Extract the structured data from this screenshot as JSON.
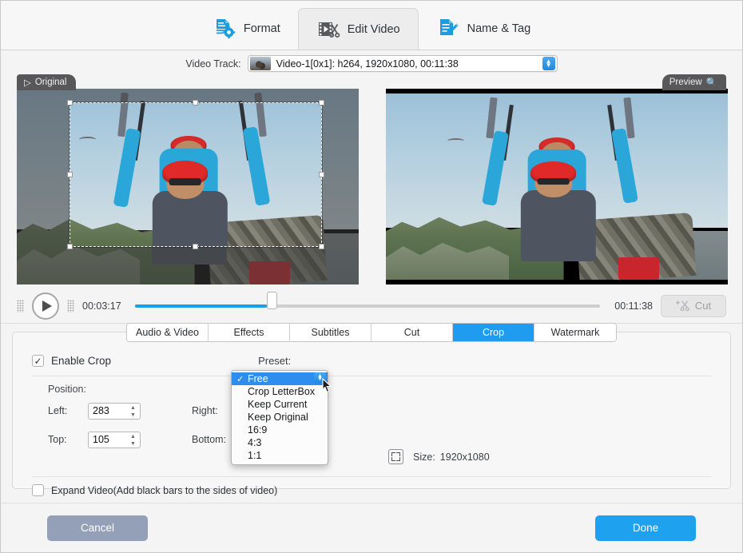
{
  "top_tabs": [
    {
      "label": "Format",
      "icon": "format-icon",
      "active": false
    },
    {
      "label": "Edit Video",
      "icon": "edit-video-icon",
      "active": true
    },
    {
      "label": "Name & Tag",
      "icon": "name-tag-icon",
      "active": false
    }
  ],
  "track": {
    "label": "Video Track:",
    "value": "Video-1[0x1]: h264, 1920x1080, 00:11:38"
  },
  "panes": {
    "original_label": "Original",
    "preview_label": "Preview"
  },
  "transport": {
    "current_time": "00:03:17",
    "total_time": "00:11:38",
    "cut_label": "Cut",
    "progress_percent": 28
  },
  "subtabs": [
    {
      "label": "Audio & Video",
      "active": false
    },
    {
      "label": "Effects",
      "active": false
    },
    {
      "label": "Subtitles",
      "active": false
    },
    {
      "label": "Cut",
      "active": false
    },
    {
      "label": "Crop",
      "active": true
    },
    {
      "label": "Watermark",
      "active": false
    }
  ],
  "crop": {
    "enable_label": "Enable Crop",
    "enable_checked": true,
    "preset_label": "Preset:",
    "preset_value": "Free",
    "position_label": "Position:",
    "left_label": "Left:",
    "left_value": "283",
    "top_label": "Top:",
    "top_value": "105",
    "right_label": "Right:",
    "bottom_label": "Bottom:",
    "size_label": "Size:",
    "size_value": "1920x1080",
    "expand_label": "Expand Video(Add black bars to the sides of video)",
    "expand_checked": false
  },
  "preset_menu": {
    "selected": "Free",
    "options": [
      "Free",
      "Crop LetterBox",
      "Keep Current",
      "Keep Original",
      "16:9",
      "4:3",
      "1:1"
    ]
  },
  "footer": {
    "cancel_label": "Cancel",
    "done_label": "Done"
  },
  "colors": {
    "accent": "#1ea1ef",
    "tab_active": "#1f9bf0",
    "menu_highlight": "#2e8ded",
    "cancel": "#93a0b8"
  }
}
